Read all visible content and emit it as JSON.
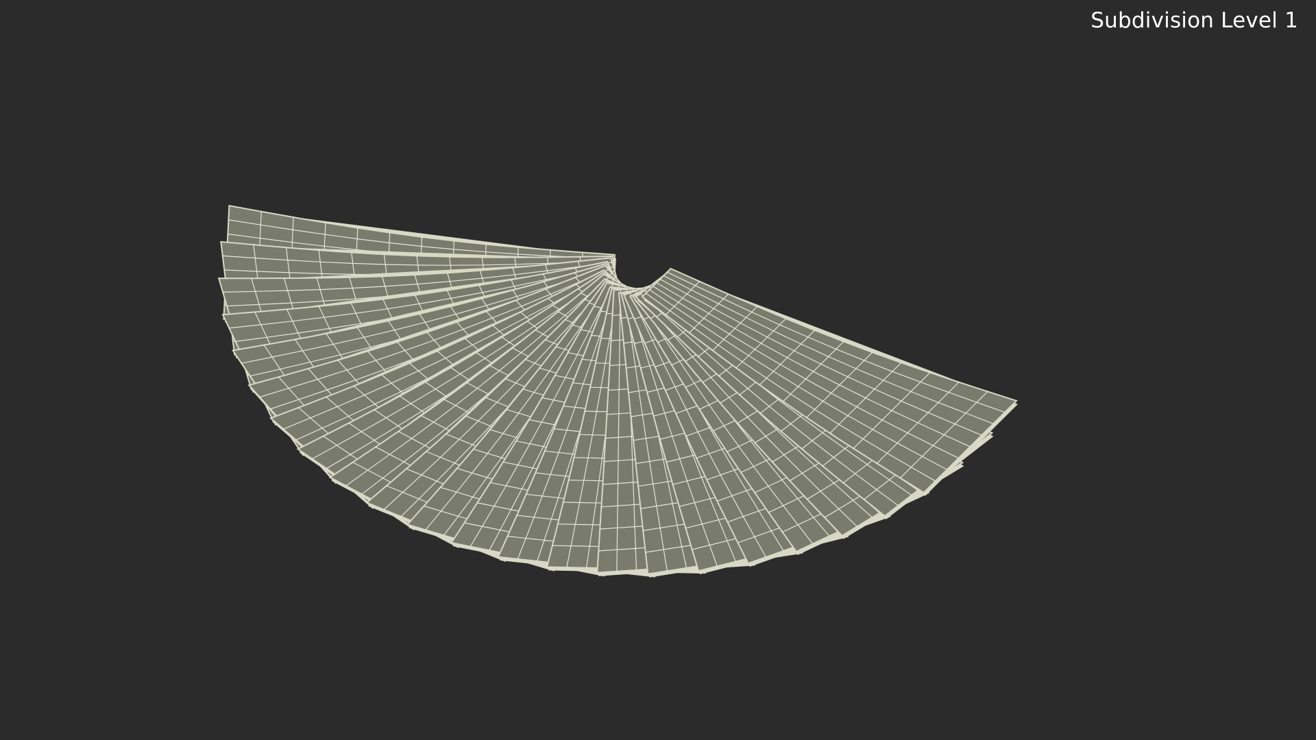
{
  "viewport": {
    "overlay_label": "Subdivision Level 1",
    "background_color": "#2b2b2b"
  },
  "model": {
    "sheet_count": 22,
    "grid_columns": 12,
    "grid_rows": 8,
    "sheet_fill_color": "#797b6d",
    "sheet_edge_color": "#d8d8c6",
    "wire_color": "#f2f2e8"
  }
}
